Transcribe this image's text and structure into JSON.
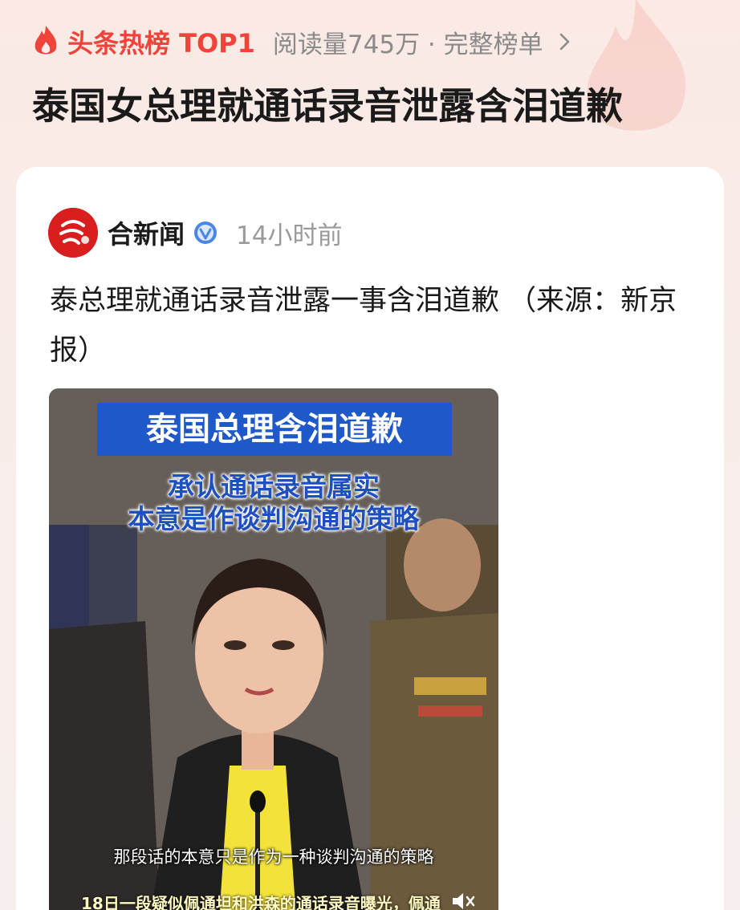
{
  "hot_rank": {
    "label": "头条热榜 TOP1",
    "meta": "阅读量745万 · 完整榜单",
    "flame_color": "#f0433a"
  },
  "headline": "泰国女总理就通话录音泄露含泪道歉",
  "post": {
    "author": "合新闻",
    "verified": true,
    "time": "14小时前",
    "text": "泰总理就通话录音泄露一事含泪道歉 （来源：新京报）"
  },
  "video": {
    "banner": "泰国总理含泪道歉",
    "subtitle_line1": "承认通话录音属实",
    "subtitle_line2": "本意是作谈判沟通的策略",
    "caption": "那段话的本意只是作为一种谈判沟通的策略",
    "caption_partial": "18日一段疑似佩通坦和洪森的通话录音曝光，佩通"
  },
  "colors": {
    "accent": "#f0433a",
    "banner_blue": "#1e58c9",
    "avatar_red": "#d81e1e"
  }
}
